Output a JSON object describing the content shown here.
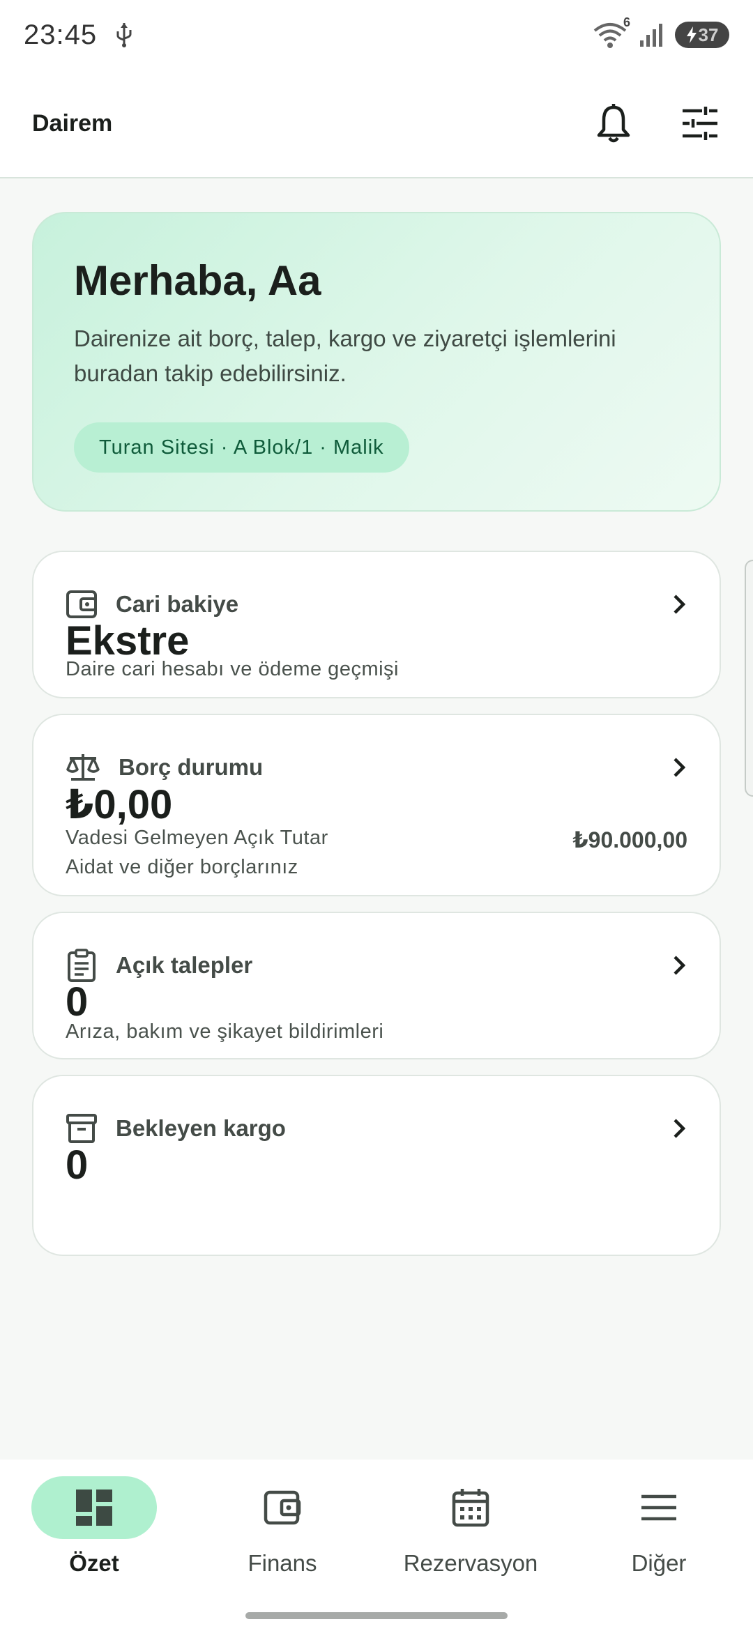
{
  "status_bar": {
    "time": "23:45",
    "wifi_badge": "6",
    "battery": "37"
  },
  "app_bar": {
    "title": "Dairem"
  },
  "hero": {
    "title": "Merhaba, Aa",
    "subtitle": "Dairenize ait borç, talep, kargo ve ziyaretçi işlemlerini buradan takip edebilirsiniz.",
    "chip": "Turan Sitesi · A Blok/1 · Malik"
  },
  "cards": {
    "balance": {
      "label": "Cari bakiye",
      "value": "Ekstre",
      "desc": "Daire cari hesabı ve ödeme geçmişi"
    },
    "debt": {
      "label": "Borç durumu",
      "value": "₺0,00",
      "desc1": "Vadesi Gelmeyen Açık Tutar",
      "extra": "₺90.000,00",
      "desc2": "Aidat ve diğer borçlarınız"
    },
    "requests": {
      "label": "Açık talepler",
      "value": "0",
      "desc": "Arıza, bakım ve şikayet bildirimleri"
    },
    "cargo": {
      "label": "Bekleyen kargo",
      "value": "0"
    }
  },
  "nav": {
    "items": [
      {
        "label": "Özet"
      },
      {
        "label": "Finans"
      },
      {
        "label": "Rezervasyon"
      },
      {
        "label": "Diğer"
      }
    ]
  }
}
